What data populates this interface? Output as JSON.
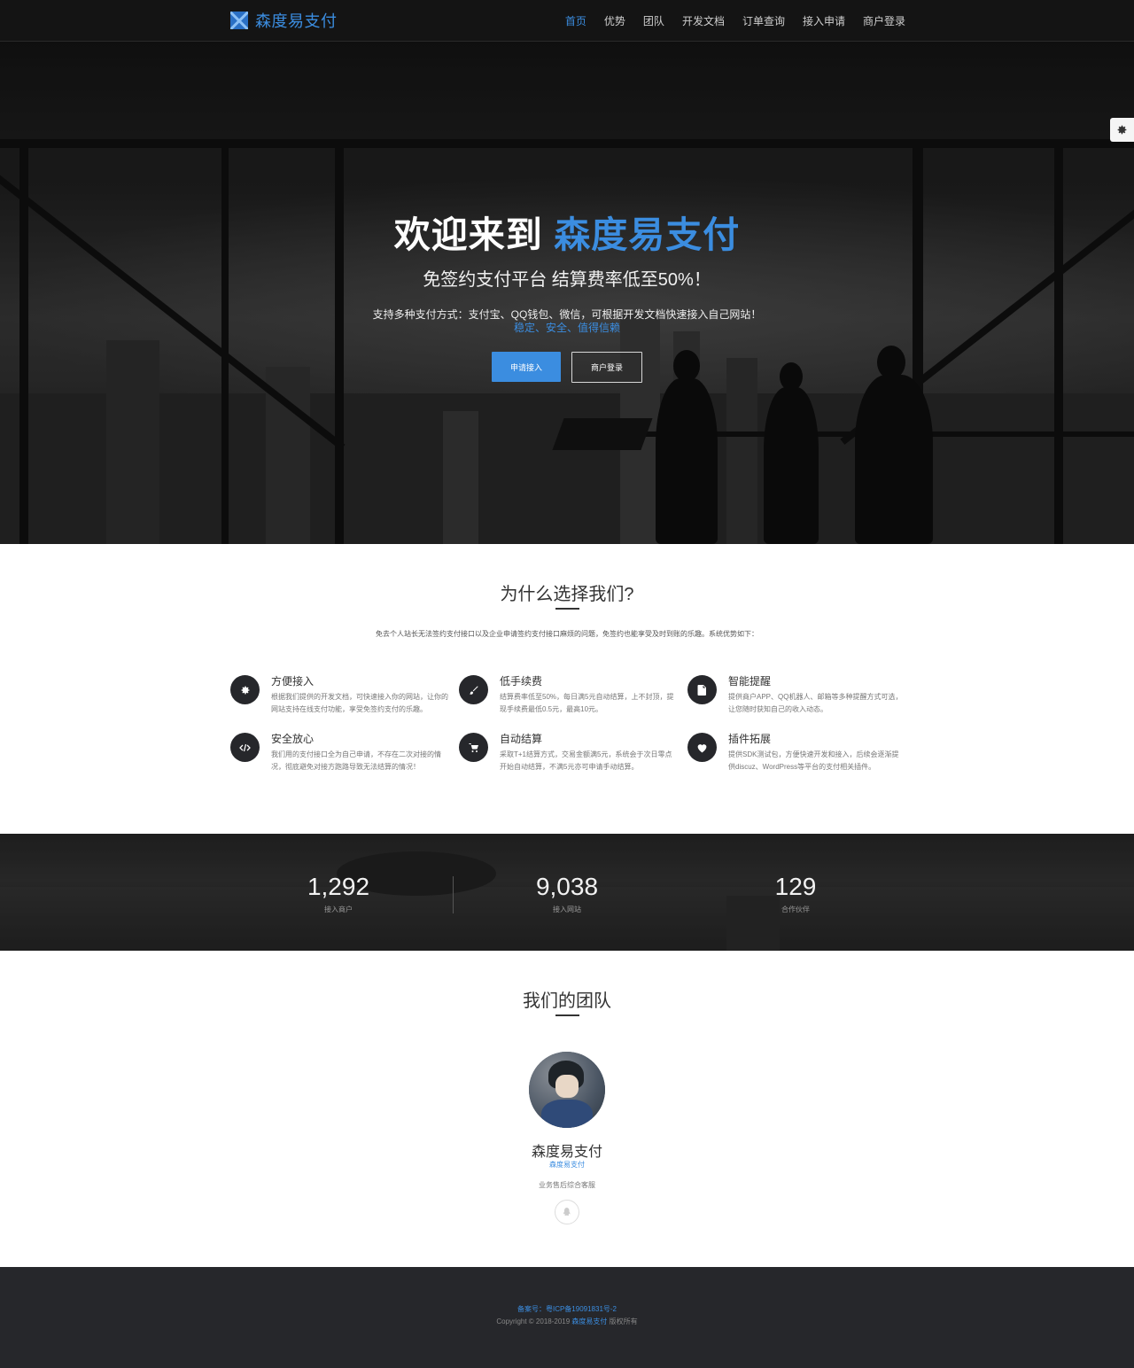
{
  "nav": {
    "brand": "森度易支付",
    "items": [
      {
        "label": "首页",
        "active": true
      },
      {
        "label": "优势",
        "active": false
      },
      {
        "label": "团队",
        "active": false
      },
      {
        "label": "开发文档",
        "active": false
      },
      {
        "label": "订单查询",
        "active": false
      },
      {
        "label": "接入申请",
        "active": false
      },
      {
        "label": "商户登录",
        "active": false
      }
    ]
  },
  "hero": {
    "title_prefix": "欢迎来到",
    "title_accent": "森度易支付",
    "subtitle": "免签约支付平台 结算费率低至50%！",
    "description": "支持多种支付方式：支付宝、QQ钱包、微信，可根据开发文档快速接入自己网站！",
    "tags": "稳定、安全、值得信赖",
    "apply_button": "申请接入",
    "login_button": "商户登录"
  },
  "why": {
    "title": "为什么选择我们?",
    "subtitle": "免去个人站长无法签约支付接口以及企业申请签约支付接口麻烦的问题，免签约也能享受及时到账的乐趣。系统优势如下：",
    "features": [
      {
        "icon": "gear-icon",
        "title": "方便接入",
        "text": "根据我们提供的开发文档，可快速接入你的网站，让你的网站支持在线支付功能，享受免签约支付的乐趣。"
      },
      {
        "icon": "brush-icon",
        "title": "低手续费",
        "text": "结算费率低至50%，每日满5元自动结算，上不封顶，提现手续费最低0.5元，最高10元。"
      },
      {
        "icon": "document-icon",
        "title": "智能提醒",
        "text": "提供商户APP、QQ机器人、邮箱等多种提醒方式可选，让您随时获知自己的收入动态。"
      },
      {
        "icon": "code-icon",
        "title": "安全放心",
        "text": "我们用的支付接口全为自己申请，不存在二次对接的情况，彻底避免对接方跑路导致无法结算的情况！"
      },
      {
        "icon": "cart-icon",
        "title": "自动结算",
        "text": "采取T+1结算方式，交易金额满5元，系统会于次日零点开始自动结算，不满5元亦可申请手动结算。"
      },
      {
        "icon": "heart-icon",
        "title": "插件拓展",
        "text": "提供SDK测试包，方便快速开发和接入，后续会逐渐提供discuz、WordPress等平台的支付相关插件。"
      }
    ]
  },
  "stats": [
    {
      "value": "1,292",
      "label": "接入商户"
    },
    {
      "value": "9,038",
      "label": "接入网站"
    },
    {
      "value": "129",
      "label": "合作伙伴"
    }
  ],
  "team": {
    "title": "我们的团队",
    "member_name": "森度易支付",
    "member_role": "森度易支付",
    "member_desc": "业务售后综合客服"
  },
  "footer": {
    "icp": "备案号：粤ICP备19091831号-2",
    "copyright_prefix": "Copyright © 2018-2019",
    "copyright_brand": "森度易支付",
    "copyright_suffix": "版权所有"
  },
  "colors": {
    "accent": "#3b8de0",
    "dark": "#26272b"
  }
}
